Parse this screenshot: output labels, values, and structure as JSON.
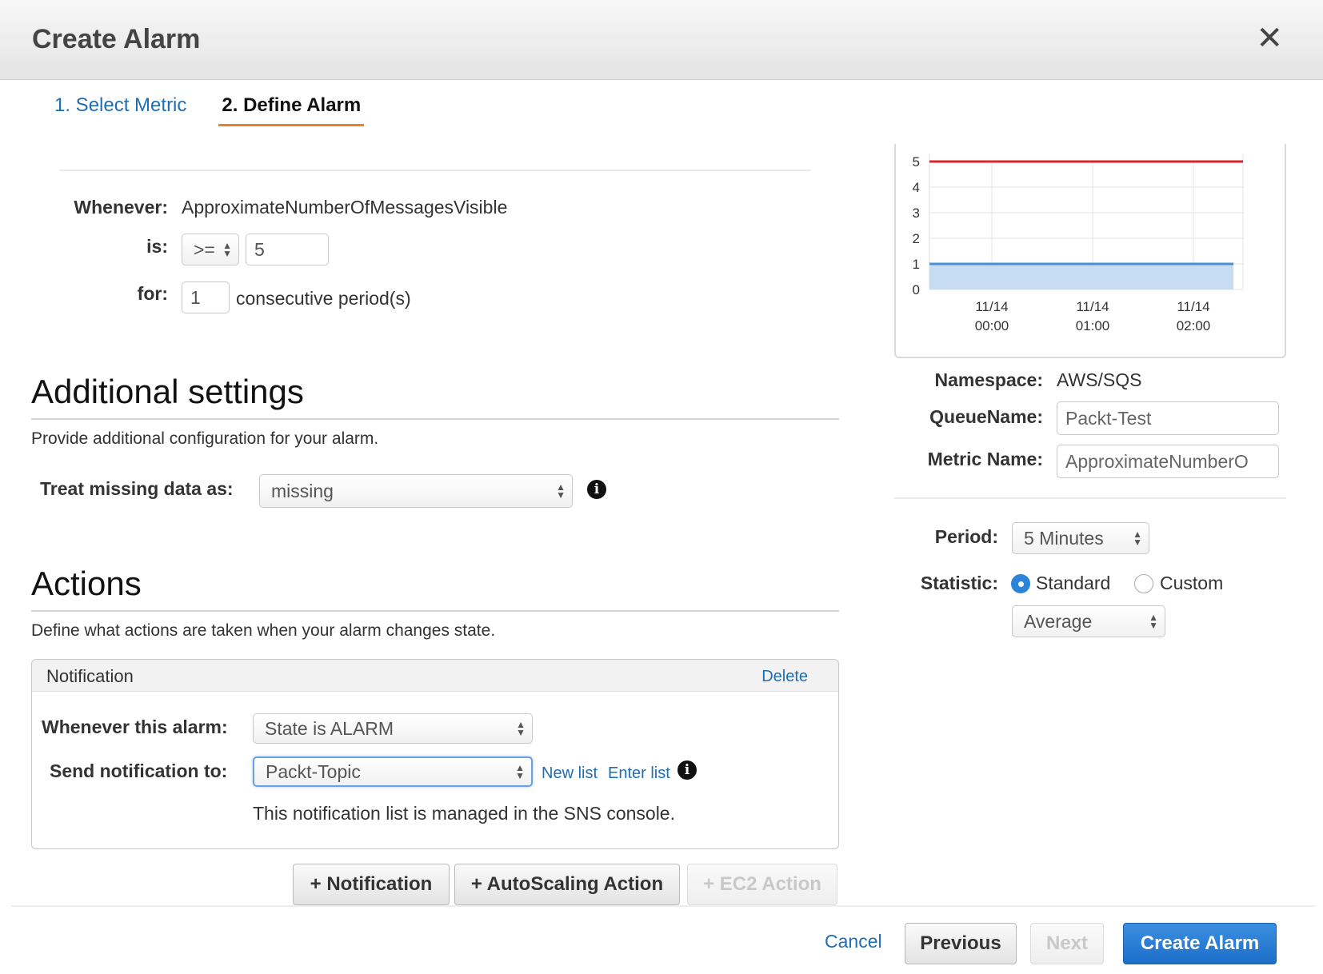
{
  "dialog": {
    "title": "Create Alarm",
    "close_glyph": "✕"
  },
  "steps": [
    {
      "label": "1. Select Metric",
      "active": false
    },
    {
      "label": "2. Define Alarm",
      "active": true
    }
  ],
  "condition": {
    "whenever_label": "Whenever:",
    "metric": "ApproximateNumberOfMessagesVisible",
    "is_label": "is:",
    "operator": ">=",
    "threshold": "5",
    "for_label": "for:",
    "periods": "1",
    "periods_suffix": "consecutive period(s)"
  },
  "additional": {
    "heading": "Additional settings",
    "description": "Provide additional configuration for your alarm.",
    "missing_label": "Treat missing data as:",
    "missing_value": "missing",
    "info_glyph": "i"
  },
  "actions": {
    "heading": "Actions",
    "description": "Define what actions are taken when your alarm changes state.",
    "notification": {
      "title": "Notification",
      "delete_label": "Delete",
      "whenever_label": "Whenever this alarm:",
      "whenever_value": "State is ALARM",
      "send_label": "Send notification to:",
      "send_value": "Packt-Topic",
      "new_list": "New list",
      "enter_list": "Enter list",
      "managed_note": "This notification list is managed in the SNS console."
    },
    "buttons": {
      "add_notification": "+ Notification",
      "add_autoscaling": "+ AutoScaling Action",
      "add_ec2": "+ EC2 Action"
    }
  },
  "footer": {
    "cancel": "Cancel",
    "previous": "Previous",
    "next": "Next",
    "create": "Create Alarm"
  },
  "metric_details": {
    "namespace_label": "Namespace:",
    "namespace_value": "AWS/SQS",
    "queue_label": "QueueName:",
    "queue_value": "Packt-Test",
    "metric_label": "Metric Name:",
    "metric_value": "ApproximateNumberO",
    "period_label": "Period:",
    "period_value": "5 Minutes",
    "statistic_label": "Statistic:",
    "statistic_standard": "Standard",
    "statistic_custom": "Custom",
    "statistic_selected": "Standard",
    "statistic_value": "Average"
  },
  "chart_data": {
    "type": "line",
    "y_ticks": [
      "5",
      "4",
      "3",
      "2",
      "1",
      "0"
    ],
    "ylim": [
      0,
      5
    ],
    "x_ticks": [
      {
        "date": "11/14",
        "time": "00:00"
      },
      {
        "date": "11/14",
        "time": "01:00"
      },
      {
        "date": "11/14",
        "time": "02:00"
      }
    ],
    "threshold": 5,
    "series_values": [
      1,
      1
    ],
    "colors": {
      "threshold": "#e0202a",
      "series": "#4a8fd6",
      "fill": "#c6dcf3"
    }
  }
}
